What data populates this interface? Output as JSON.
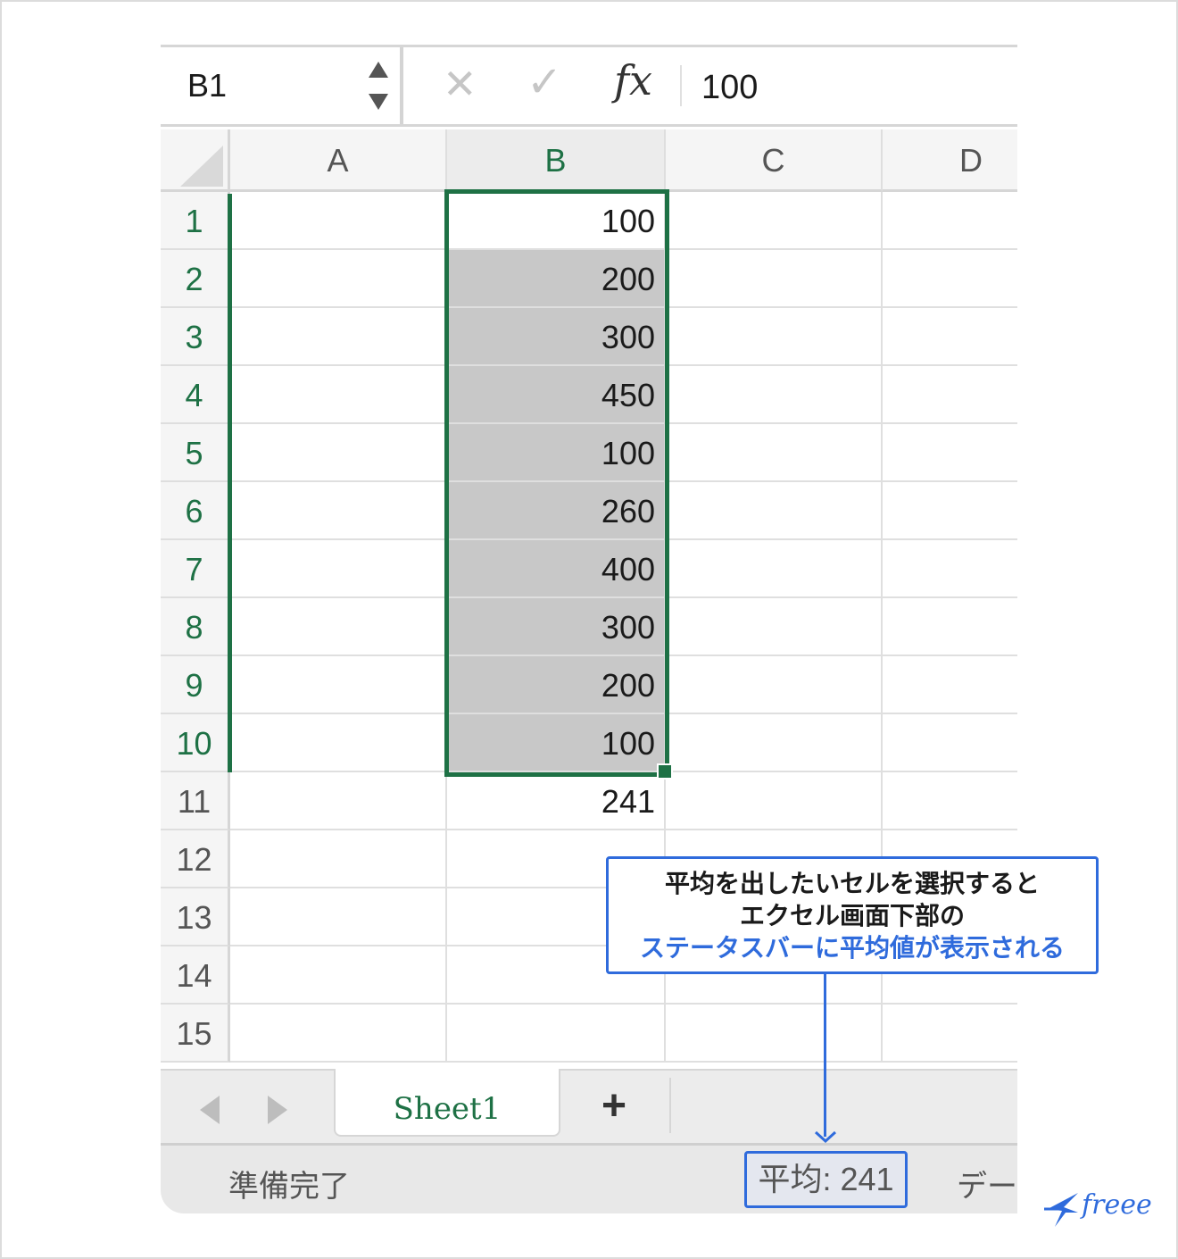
{
  "formula_bar": {
    "name_box": "B1",
    "formula_value": "100",
    "fx_label": "fx",
    "cancel_glyph": "✕",
    "enter_glyph": "✓"
  },
  "grid": {
    "columns": [
      "A",
      "B",
      "C",
      "D"
    ],
    "selected_column": "B",
    "rows": [
      {
        "num": "1",
        "b": "100"
      },
      {
        "num": "2",
        "b": "200"
      },
      {
        "num": "3",
        "b": "300"
      },
      {
        "num": "4",
        "b": "450"
      },
      {
        "num": "5",
        "b": "100"
      },
      {
        "num": "6",
        "b": "260"
      },
      {
        "num": "7",
        "b": "400"
      },
      {
        "num": "8",
        "b": "300"
      },
      {
        "num": "9",
        "b": "200"
      },
      {
        "num": "10",
        "b": "100"
      },
      {
        "num": "11",
        "b": "241"
      },
      {
        "num": "12",
        "b": ""
      },
      {
        "num": "13",
        "b": ""
      },
      {
        "num": "14",
        "b": ""
      },
      {
        "num": "15",
        "b": ""
      }
    ],
    "selected_range": "B1:B10"
  },
  "sheet_tabs": {
    "active_sheet": "Sheet1",
    "add_label": "+"
  },
  "status_bar": {
    "ready": "準備完了",
    "average": "平均: 241",
    "data_cut": "デー"
  },
  "callout": {
    "line1": "平均を出したいセルを選択すると",
    "line2": "エクセル画面下部の",
    "line3": "ステータスバーに平均値が表示される"
  },
  "logo": {
    "wordmark": "freee"
  },
  "colors": {
    "excel_green": "#1e7145",
    "accent_blue": "#2f6bdc",
    "selection_shade": "#c8c8c8"
  },
  "icons": [
    "stepper-icon",
    "cancel-icon",
    "enter-icon",
    "fx-icon",
    "select-all-icon",
    "prev-sheet-icon",
    "next-sheet-icon",
    "add-sheet-icon",
    "freee-bird-icon"
  ]
}
